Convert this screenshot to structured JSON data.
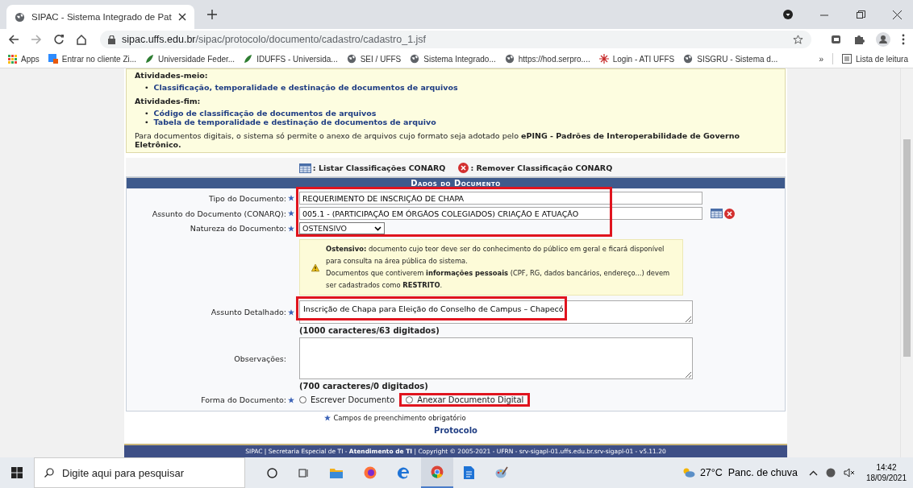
{
  "browser": {
    "tab": {
      "title": "SIPAC - Sistema Integrado de Pat"
    },
    "url_host": "sipac.uffs.edu.br",
    "url_path": "/sipac/protocolo/documento/cadastro/cadastro_1.jsf",
    "bookmarks": [
      "Apps",
      "Entrar no cliente Zi...",
      "Universidade Feder...",
      "IDUFFS - Universida...",
      "SEI / UFFS",
      "Sistema Integrado...",
      "https://hod.serpro....",
      "Login - ATI UFFS",
      "SISGRU - Sistema d..."
    ],
    "overflow": "»",
    "reading_list": "Lista de leitura"
  },
  "info": {
    "bullet": "•",
    "sections": [
      {
        "heading": "Atividades-meio:",
        "links": [
          "Classificação, temporalidade e destinação de documentos de arquivos"
        ]
      },
      {
        "heading": "Atividades-fim:",
        "links": [
          "Código de classificação de documentos de arquivos",
          "Tabela de temporalidade e destinação de documentos de arquivo"
        ]
      }
    ],
    "note": "Para documentos digitais, o sistema só permite o anexo de arquivos cujo formato seja adotado pelo **ePING - Padrões de Interoperabilidade de Governo Eletrônico.**"
  },
  "actions": [
    {
      "kind": "list",
      "label": ": Listar Classificações CONARQ"
    },
    {
      "kind": "remove",
      "label": ": Remover Classificação CONARQ"
    }
  ],
  "form": {
    "title": "Dados do Documento",
    "tipo": {
      "label": "Tipo do Documento:",
      "value": "REQUERIMENTO DE INSCRIÇÃO DE CHAPA"
    },
    "assunto": {
      "label": "Assunto do Documento (CONARQ):",
      "value": "005.1 - (PARTICIPAÇÃO EM ÓRGÃOS COLEGIADOS) CRIAÇÃO E ATUAÇÃO"
    },
    "natureza": {
      "label": "Natureza do Documento:",
      "value": "OSTENSIVO"
    },
    "warning": [
      "**Ostensivo:** documento cujo teor deve ser do conhecimento do público em geral e ficará disponível para consulta na área pública do sistema.",
      "Documentos que contiverem **informações pessoais** (CPF, RG, dados bancários, endereço...) devem ser cadastrados como **RESTRITO**."
    ],
    "detalhado": {
      "label": "Assunto Detalhado:",
      "value": "Inscrição de Chapa para Eleição do Conselho de Campus – Chapecó",
      "count": "(1000 caracteres/63 digitados)"
    },
    "observacoes": {
      "label": "Observações:",
      "count": "(700 caracteres/0 digitados)"
    },
    "forma": {
      "label": "Forma do Documento:",
      "options": [
        {
          "label": "Escrever Documento",
          "selected": false
        },
        {
          "label": "Anexar Documento Digital",
          "selected": false
        }
      ]
    },
    "required_note": "Campos de preenchimento obrigatório"
  },
  "module_link": "Protocolo",
  "footer": "SIPAC | Secretaria Especial de TI - **Atendimento de TI** | Copyright © 2005-2021 - UFRN - srv-sigapl-01.uffs.edu.br.srv-sigapl-01 - v5.11.20",
  "taskbar": {
    "search_placeholder": "Digite aqui para pesquisar",
    "weather": "27°C  Panc. de chuva",
    "time": "14:42",
    "date": "18/09/2021"
  }
}
